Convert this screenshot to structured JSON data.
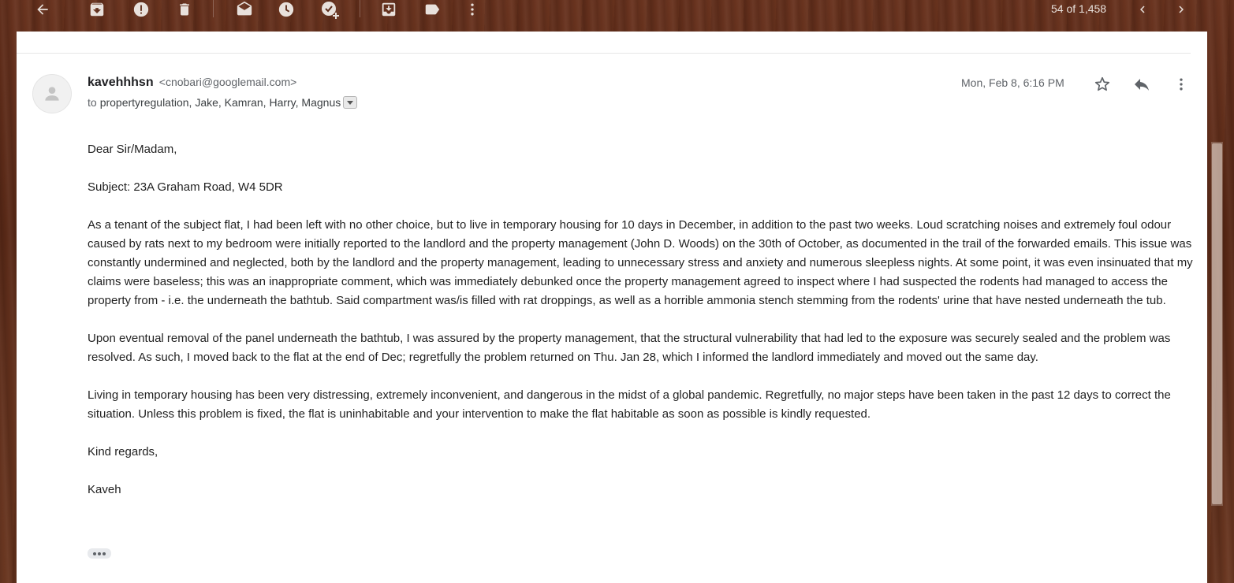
{
  "toolbar": {
    "icons": [
      "back-arrow-icon",
      "archive-icon",
      "report-spam-icon",
      "delete-icon",
      "mark-unread-icon",
      "snooze-icon",
      "add-to-tasks-icon",
      "move-to-icon",
      "labels-icon",
      "more-vert-icon"
    ],
    "pager": "54 of 1,458"
  },
  "message": {
    "sender_name": "kavehhhsn",
    "sender_email": "<cnobari@googlemail.com>",
    "to_prefix": "to",
    "recipients": "propertyregulation, Jake, Kamran, Harry, Magnus",
    "date": "Mon, Feb 8, 6:16 PM",
    "body": [
      "Dear Sir/Madam,",
      "Subject: 23A Graham Road, W4 5DR",
      "As a tenant of the subject flat, I had been left with no other choice, but to live in temporary housing for 10 days in December, in addition to the past two weeks. Loud scratching noises and extremely foul odour caused by rats next to my bedroom were initially reported to the landlord and the property management (John D. Woods) on the 30th of October, as documented in the trail of the forwarded emails. This issue was constantly undermined and neglected, both by the landlord and the property management, leading to unnecessary stress and anxiety and numerous sleepless nights. At some point, it was even insinuated that my claims were baseless; this was an inappropriate comment, which was immediately debunked once the property management agreed to inspect where I had suspected the rodents had managed to access the property from - i.e. the underneath the bathtub. Said compartment was/is filled with rat droppings, as well as a horrible ammonia stench stemming from the rodents' urine that have nested underneath the tub.",
      "Upon eventual removal of the panel underneath the bathtub, I was assured by the property management, that the structural vulnerability that had led to the exposure was securely sealed and the problem was resolved. As such, I moved back to the flat at the end of Dec; regretfully the problem returned on Thu. Jan 28, which I informed the landlord immediately and moved out the same day.",
      "Living in temporary housing has been very distressing, extremely inconvenient, and dangerous in the midst of a global pandemic. Regretfully, no major steps have been taken in the past 12 days to correct the situation. Unless this problem is fixed, the flat is uninhabitable and your intervention to make the flat habitable as soon as possible is kindly requested.",
      "Kind regards,",
      "Kaveh"
    ]
  },
  "colors": {
    "toolbar_icon": "#e8e1dc",
    "card_bg": "#ffffff",
    "text": "#222222",
    "muted": "#5f6368"
  }
}
